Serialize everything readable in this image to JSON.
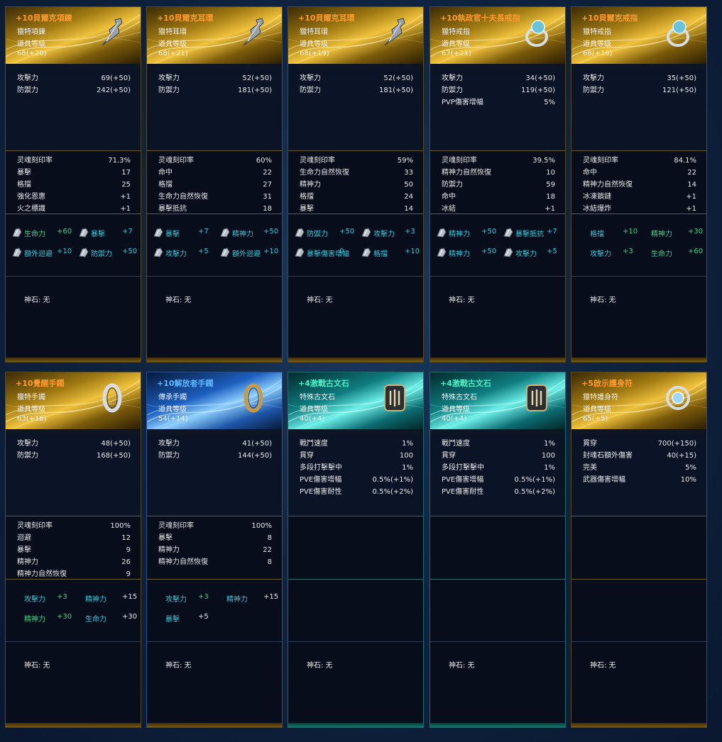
{
  "god_stone_label": "神石: 无",
  "cards": [
    {
      "theme": "gold",
      "name": "+10貝爾克項鍊",
      "meta": [
        "獵特項鍊",
        "道具等级",
        "68(+20)"
      ],
      "icon": "necklace-icon",
      "basic": [
        [
          "攻擊力",
          "69(+50)"
        ],
        [
          "防禦力",
          "242(+50)"
        ]
      ],
      "soul": [
        [
          "灵魂刻印率",
          "71.3%"
        ],
        [
          "暴擊",
          "17"
        ],
        [
          "格擋",
          "25"
        ],
        [
          "強化恩惠",
          "+1"
        ],
        [
          "火之標識",
          "+1"
        ]
      ],
      "ench": [
        [
          "生命力",
          "+60",
          true
        ],
        [
          "暴擊",
          "+7",
          false
        ],
        [
          "額外迴避",
          "+10",
          false
        ],
        [
          "防禦力",
          "+50",
          false
        ]
      ]
    },
    {
      "theme": "gold",
      "name": "+10貝爾克耳環",
      "meta": [
        "獵特耳環",
        "道具等级",
        "68(+21)"
      ],
      "icon": "earring-icon",
      "basic": [
        [
          "攻擊力",
          "52(+50)"
        ],
        [
          "防禦力",
          "181(+50)"
        ]
      ],
      "soul": [
        [
          "灵魂刻印率",
          "60%"
        ],
        [
          "命中",
          "22"
        ],
        [
          "格擋",
          "27"
        ],
        [
          "生命力自然恢復",
          "31"
        ],
        [
          "暴擊抵抗",
          "18"
        ]
      ],
      "ench": [
        [
          "暴擊",
          "+7",
          false
        ],
        [
          "精神力",
          "+50",
          false
        ],
        [
          "攻擊力",
          "+5",
          false
        ],
        [
          "額外迴避",
          "+10",
          false
        ]
      ]
    },
    {
      "theme": "gold",
      "name": "+10貝爾克耳環",
      "meta": [
        "獵特耳環",
        "道具等级",
        "68(+19)"
      ],
      "icon": "earring-icon",
      "basic": [
        [
          "攻擊力",
          "52(+50)"
        ],
        [
          "防禦力",
          "181(+50)"
        ]
      ],
      "soul": [
        [
          "灵魂刻印率",
          "59%"
        ],
        [
          "生命力自然恢復",
          "33"
        ],
        [
          "精神力",
          "50"
        ],
        [
          "格擋",
          "24"
        ],
        [
          "暴擊",
          "14"
        ]
      ],
      "ench": [
        [
          "防禦力",
          "+50",
          false
        ],
        [
          "攻擊力",
          "+3",
          false
        ],
        [
          "暴擊傷害增幅",
          "0",
          false
        ],
        [
          "格擋",
          "+10",
          false
        ]
      ]
    },
    {
      "theme": "gold",
      "name": "+10執政官十夫長戒指",
      "meta": [
        "獵特戒指",
        "道具等级",
        "67(+21)"
      ],
      "icon": "ring-icon",
      "basic": [
        [
          "攻擊力",
          "34(+50)"
        ],
        [
          "防禦力",
          "119(+50)"
        ],
        [
          "PVP傷害增幅",
          "5%"
        ]
      ],
      "soul": [
        [
          "灵魂刻印率",
          "39.5%"
        ],
        [
          "精神力自然恢復",
          "10"
        ],
        [
          "防禦力",
          "59"
        ],
        [
          "命中",
          "18"
        ],
        [
          "冰結",
          "+1"
        ]
      ],
      "ench": [
        [
          "精神力",
          "+50",
          false
        ],
        [
          "暴擊抵抗",
          "+7",
          false
        ],
        [
          "精神力",
          "+50",
          false
        ],
        [
          "攻擊力",
          "+5",
          false
        ]
      ]
    },
    {
      "theme": "gold",
      "name": "+10貝爾克戒指",
      "meta": [
        "獵特戒指",
        "道具等级",
        "68(+18)"
      ],
      "icon": "ring-icon",
      "basic": [
        [
          "攻擊力",
          "35(+50)"
        ],
        [
          "防禦力",
          "121(+50)"
        ]
      ],
      "soul": [
        [
          "灵魂刻印率",
          "84.1%"
        ],
        [
          "命中",
          "22"
        ],
        [
          "精神力自然恢復",
          "14"
        ],
        [
          "冰凍鎖鏈",
          "+1"
        ],
        [
          "冰結爆炸",
          "+1"
        ]
      ],
      "ench": [
        [
          "格擋",
          "+10",
          false
        ],
        [
          "精神力",
          "+30",
          true
        ],
        [
          "攻擊力",
          "+3",
          false
        ],
        [
          "生命力",
          "+60",
          true
        ]
      ]
    },
    {
      "theme": "gold",
      "name": "+10覺醒手鐲",
      "meta": [
        "獵特手鐲",
        "道具等级",
        "63(+16)"
      ],
      "icon": "bracelet-icon",
      "basic": [
        [
          "攻擊力",
          "48(+50)"
        ],
        [
          "防禦力",
          "168(+50)"
        ]
      ],
      "soul": [
        [
          "灵魂刻印率",
          "100%"
        ],
        [
          "迴避",
          "12"
        ],
        [
          "暴擊",
          "9"
        ],
        [
          "精神力",
          "26"
        ],
        [
          "精神力自然恢復",
          "9"
        ]
      ],
      "ench": [
        [
          "攻擊力",
          "+3",
          false
        ],
        [
          "精神力",
          "+15",
          false
        ],
        [
          "精神力",
          "+30",
          true
        ],
        [
          "生命力",
          "+30",
          false
        ]
      ]
    },
    {
      "theme": "blue",
      "name": "+10解放者手鐲",
      "meta": [
        "傳承手鐲",
        "道具等级",
        "54(+14)"
      ],
      "icon": "bracelet-icon",
      "basic": [
        [
          "攻擊力",
          "41(+50)"
        ],
        [
          "防禦力",
          "144(+50)"
        ]
      ],
      "soul": [
        [
          "灵魂刻印率",
          "100%"
        ],
        [
          "暴擊",
          "8"
        ],
        [
          "精神力",
          "22"
        ],
        [
          "精神力自然恢復",
          "8"
        ]
      ],
      "ench": [
        [
          "攻擊力",
          "+3",
          false
        ],
        [
          "精神力",
          "+15",
          false
        ],
        [
          "暴擊",
          "+5",
          false
        ]
      ]
    },
    {
      "theme": "teal",
      "name": "+4激戰古文石",
      "meta": [
        "特殊古文石",
        "道具等级",
        "40(+4)"
      ],
      "icon": "rune-stone-icon",
      "basic": [
        [
          "戰鬥速度",
          "1%"
        ],
        [
          "貫穿",
          "100"
        ],
        [
          "多段打擊擊中",
          "1%"
        ],
        [
          "PVE傷害增幅",
          "0.5%(+1%)"
        ],
        [
          "PVE傷害耐性",
          "0.5%(+2%)"
        ]
      ],
      "soul": [],
      "ench": []
    },
    {
      "theme": "teal",
      "name": "+4激戰古文石",
      "meta": [
        "特殊古文石",
        "道具等级",
        "40(+4)"
      ],
      "icon": "rune-stone-icon",
      "basic": [
        [
          "戰鬥速度",
          "1%"
        ],
        [
          "貫穿",
          "100"
        ],
        [
          "多段打擊擊中",
          "1%"
        ],
        [
          "PVE傷害增幅",
          "0.5%(+1%)"
        ],
        [
          "PVE傷害耐性",
          "0.5%(+2%)"
        ]
      ],
      "soul": [],
      "ench": []
    },
    {
      "theme": "gold",
      "name": "+5啟示護身符",
      "meta": [
        "獵特護身符",
        "道具等级",
        "65(+5)"
      ],
      "icon": "amulet-icon",
      "basic": [
        [
          "貫穿",
          "700(+150)"
        ],
        [
          "封魂石額外傷害",
          "40(+15)"
        ],
        [
          "完美",
          "5%"
        ],
        [
          "武器傷害增幅",
          "10%"
        ]
      ],
      "soul": [],
      "ench": []
    }
  ]
}
